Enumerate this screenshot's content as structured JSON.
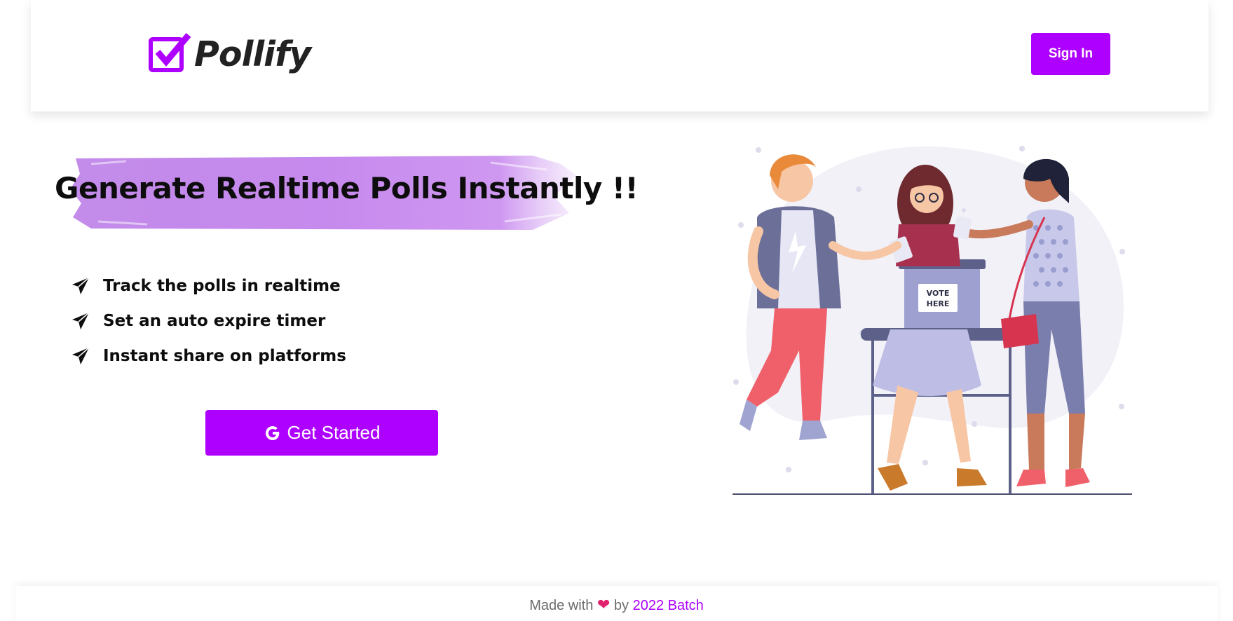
{
  "header": {
    "brand": "Pollify",
    "sign_in_label": "Sign In"
  },
  "hero": {
    "headline": "Generate Realtime Polls Instantly !!",
    "features": [
      {
        "icon": "paper-plane-icon",
        "text": "Track the polls in realtime"
      },
      {
        "icon": "paper-plane-icon",
        "text": "Set an auto expire timer"
      },
      {
        "icon": "paper-plane-icon",
        "text": "Instant share on platforms"
      }
    ],
    "cta_label": "Get Started",
    "cta_icon": "google-icon"
  },
  "illustration": {
    "ballot_box_text": [
      "VOTE",
      "HERE"
    ]
  },
  "footer": {
    "made_with": "Made with",
    "by": "by",
    "link_text": "2022 Batch"
  },
  "colors": {
    "accent": "#ad00ff",
    "heart": "#e0216b",
    "brush": "#c27ee8"
  }
}
